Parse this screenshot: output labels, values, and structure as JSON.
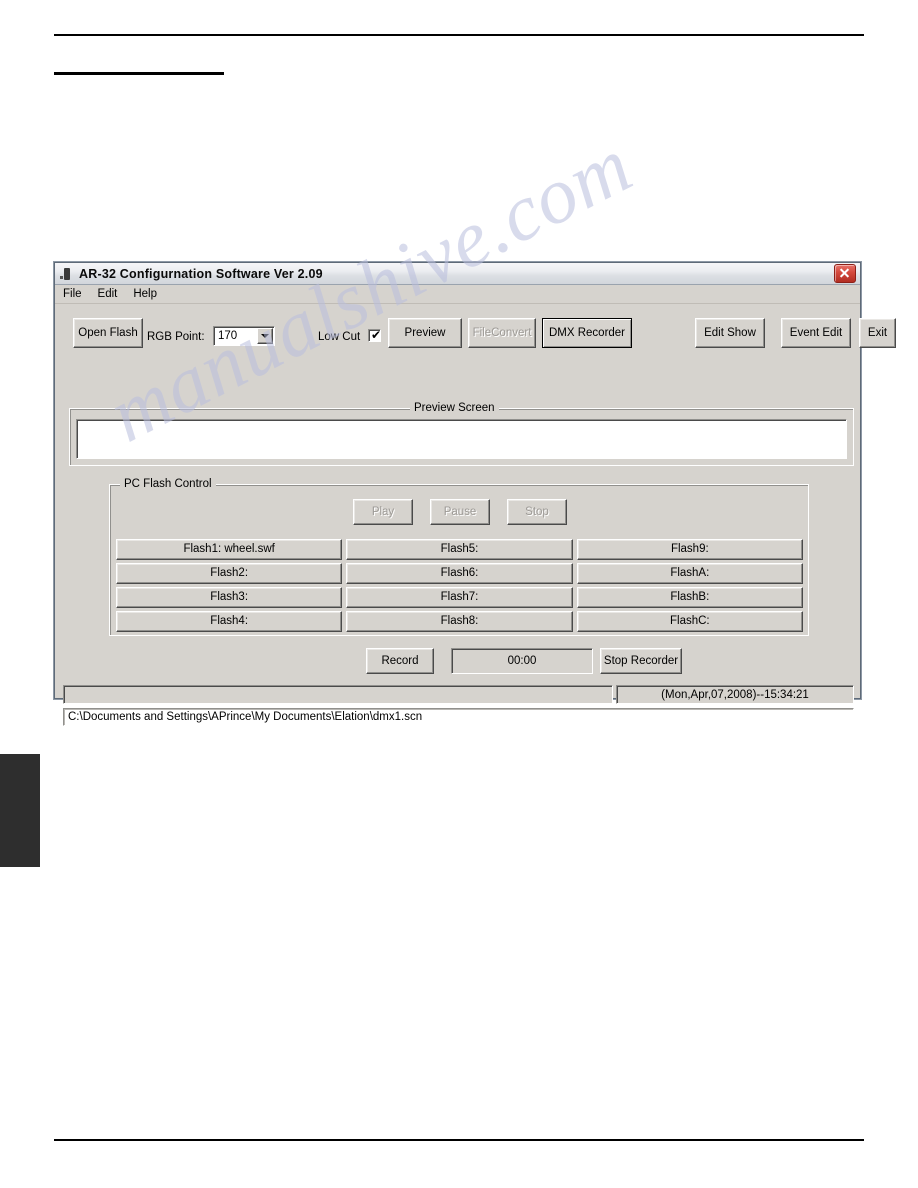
{
  "window": {
    "title": "AR-32 Configurnation Software Ver 2.09",
    "close_label": "×"
  },
  "menu": {
    "items": [
      {
        "label": "File"
      },
      {
        "label": "Edit"
      },
      {
        "label": "Help"
      }
    ]
  },
  "toolbar": {
    "open_flash": "Open Flash",
    "rgb_point_label": "RGB Point:",
    "rgb_point_value": "170",
    "low_cut_label": "Low Cut",
    "low_cut_checked": "✔",
    "preview": "Preview",
    "file_convert": "FileConvert",
    "dmx_recorder": "DMX Recorder",
    "edit_show": "Edit Show",
    "event_edit": "Event Edit",
    "exit": "Exit"
  },
  "preview_screen": {
    "caption": "Preview Screen",
    "content": ""
  },
  "flash_control": {
    "caption": "PC Flash Control",
    "play": "Play",
    "pause": "Pause",
    "stop": "Stop",
    "cells": [
      {
        "label": "Flash1: wheel.swf"
      },
      {
        "label": "Flash5:"
      },
      {
        "label": "Flash9:"
      },
      {
        "label": "Flash2:"
      },
      {
        "label": "Flash6:"
      },
      {
        "label": "FlashA:"
      },
      {
        "label": "Flash3:"
      },
      {
        "label": "Flash7:"
      },
      {
        "label": "FlashB:"
      },
      {
        "label": "Flash4:"
      },
      {
        "label": "Flash8:"
      },
      {
        "label": "FlashC:"
      }
    ]
  },
  "recorder": {
    "record": "Record",
    "timer": "00:00",
    "stop_recorder": "Stop Recorder"
  },
  "status": {
    "left": "",
    "timestamp": "(Mon,Apr,07,2008)--15:34:21",
    "path": "C:\\Documents and Settings\\APrince\\My Documents\\Elation\\dmx1.scn"
  },
  "page": {
    "watermark": "manualshive.com"
  }
}
